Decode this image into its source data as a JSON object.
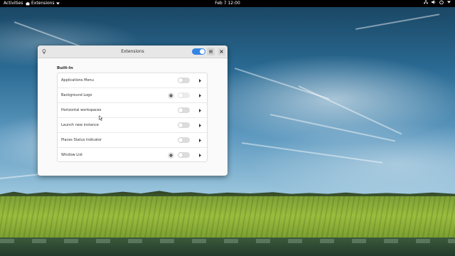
{
  "topbar": {
    "activities": "Activities",
    "app_name": "Extensions",
    "app_icon": "puzzle-icon",
    "clock": "Feb 7  12:00",
    "status_icons": [
      "network-icon",
      "volume-icon",
      "power-icon",
      "chevron-down-icon"
    ]
  },
  "window": {
    "title": "Extensions",
    "left_icon": "lightbulb-icon",
    "global_switch_on": true,
    "menu_icon": "hamburger-menu-icon",
    "close_icon": "close-icon",
    "section_title": "Built-In",
    "extensions": [
      {
        "name": "Applications Menu",
        "enabled": false,
        "has_settings": false
      },
      {
        "name": "Background Logo",
        "enabled": false,
        "has_settings": true,
        "dimmed": true
      },
      {
        "name": "Horizontal workspaces",
        "enabled": false,
        "has_settings": false
      },
      {
        "name": "Launch new instance",
        "enabled": false,
        "has_settings": false
      },
      {
        "name": "Places Status Indicator",
        "enabled": false,
        "has_settings": false
      },
      {
        "name": "Window List",
        "enabled": false,
        "has_settings": true
      }
    ]
  },
  "colors": {
    "accent": "#3584e4",
    "topbar": "#000000",
    "window_bg": "#fafafa",
    "headerbar": "#e7e7e7"
  }
}
